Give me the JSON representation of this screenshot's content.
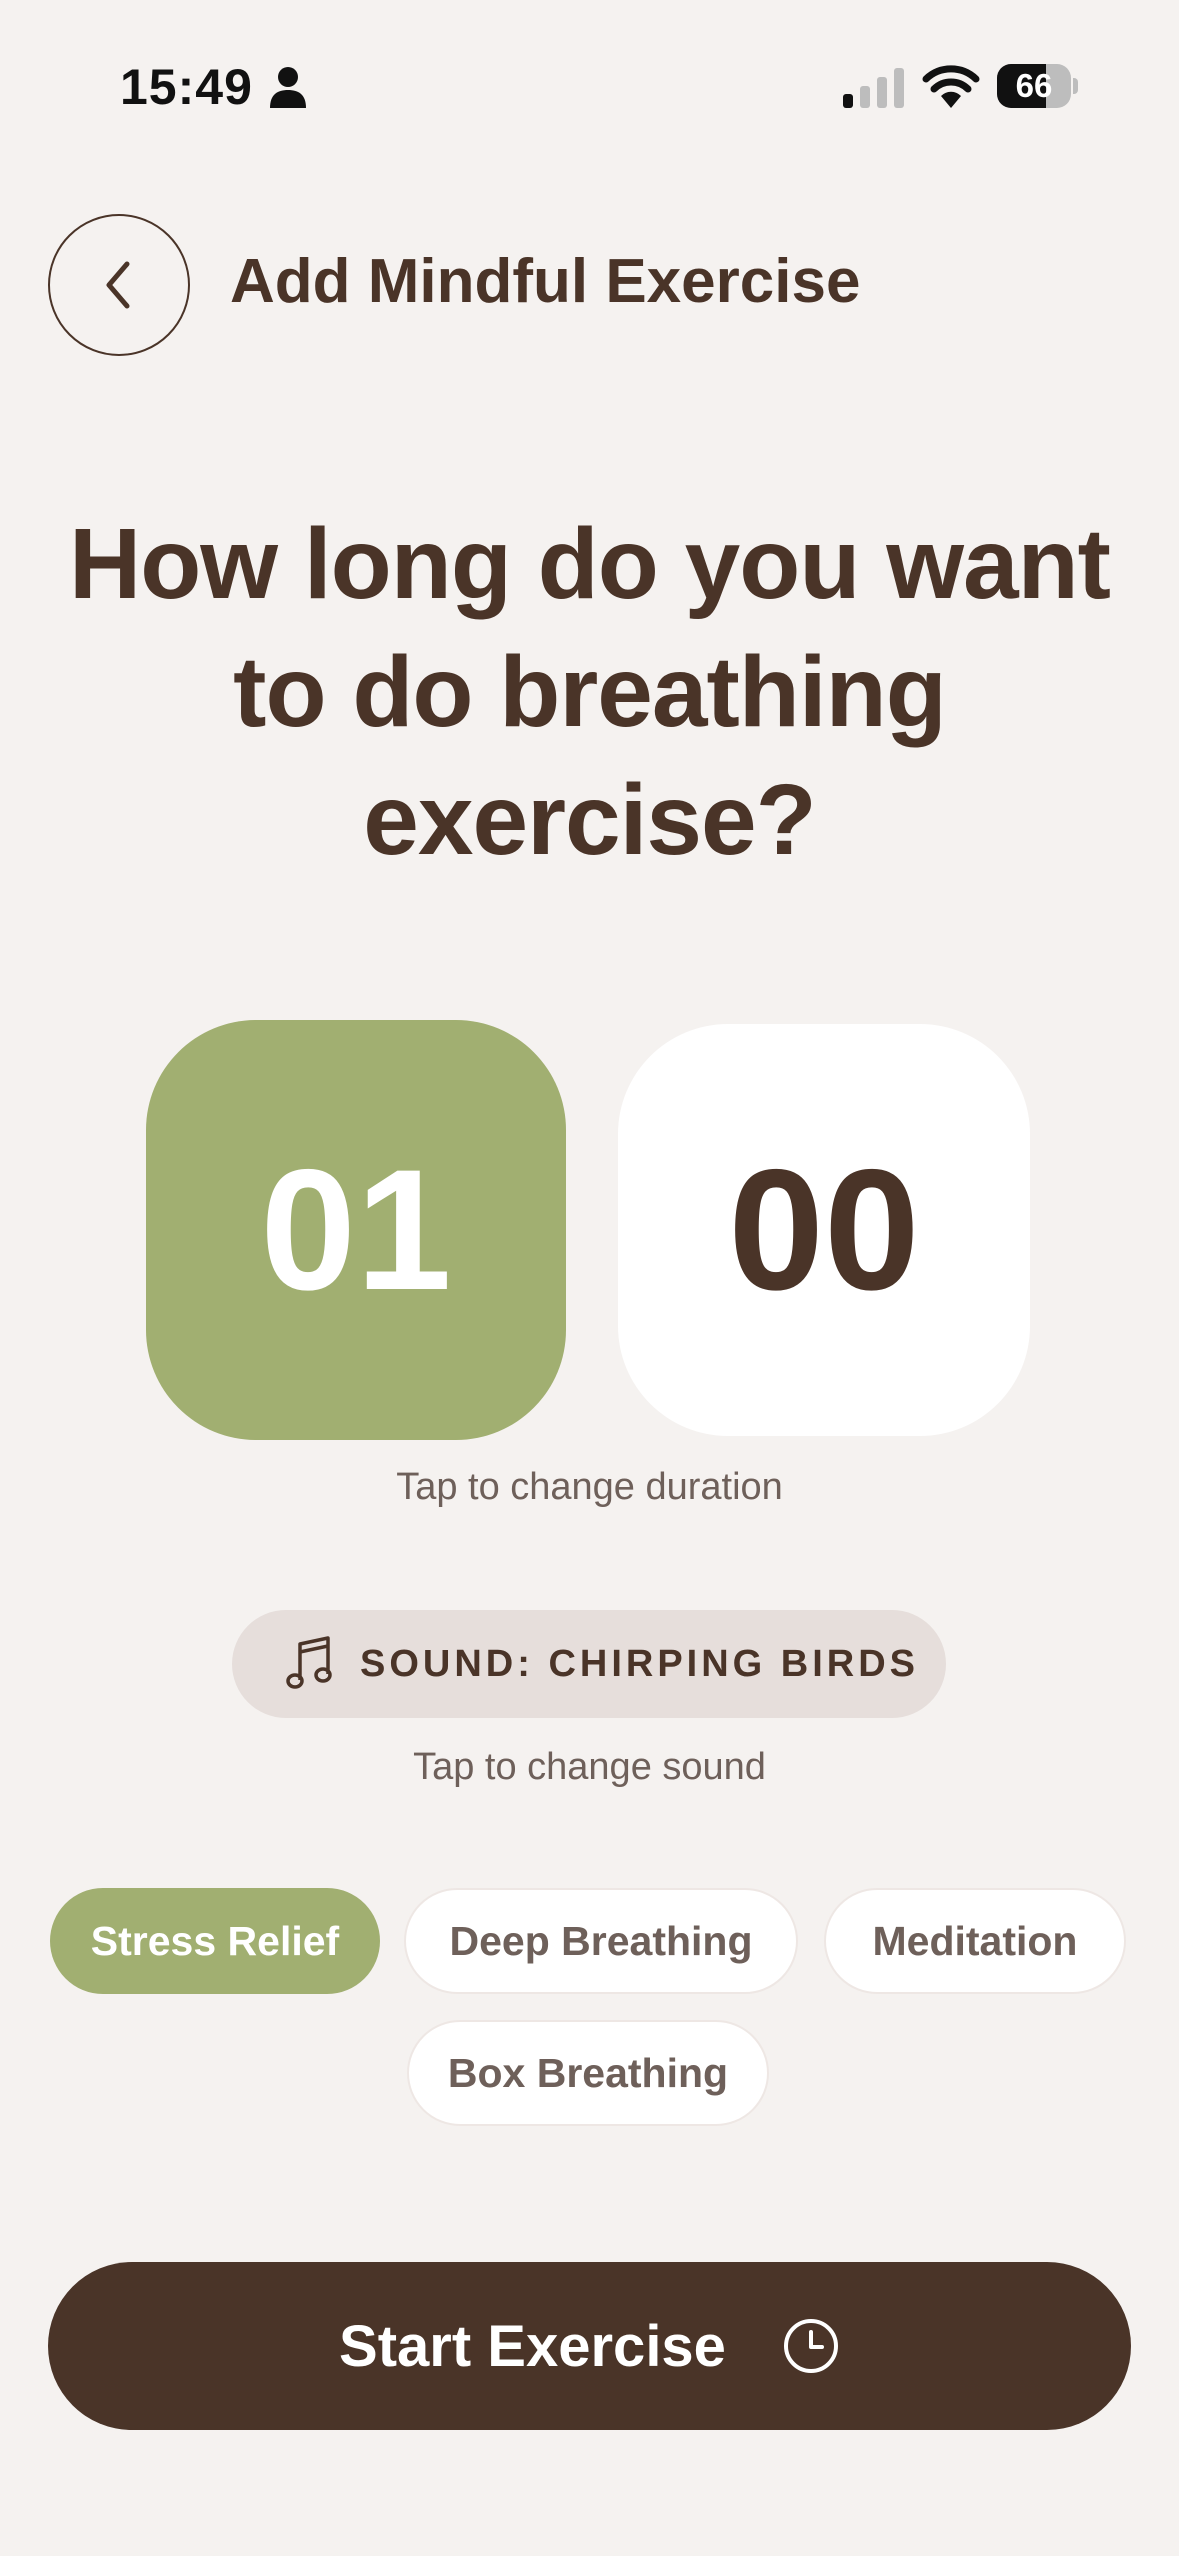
{
  "status_bar": {
    "time": "15:49",
    "battery": "66",
    "battery_level": 0.66
  },
  "header": {
    "back_icon": "chevron-left-icon",
    "title": "Add Mindful Exercise"
  },
  "question": "How long do you want to do breathing exercise?",
  "duration": {
    "minutes": "01",
    "seconds": "00",
    "hint": "Tap to change duration"
  },
  "sound": {
    "icon": "music-note-icon",
    "label": "SOUND: CHIRPING BIRDS",
    "hint": "Tap to change sound"
  },
  "chips": [
    {
      "label": "Stress Relief",
      "selected": true
    },
    {
      "label": "Deep Breathing",
      "selected": false
    },
    {
      "label": "Meditation",
      "selected": false
    },
    {
      "label": "Box Breathing",
      "selected": false
    }
  ],
  "start_button": {
    "label": "Start Exercise",
    "icon": "clock-icon"
  },
  "colors": {
    "background": "#f5f2f0",
    "primary_brown": "#4a3428",
    "accent_green": "#a1af71",
    "muted_text": "#6e605a"
  }
}
